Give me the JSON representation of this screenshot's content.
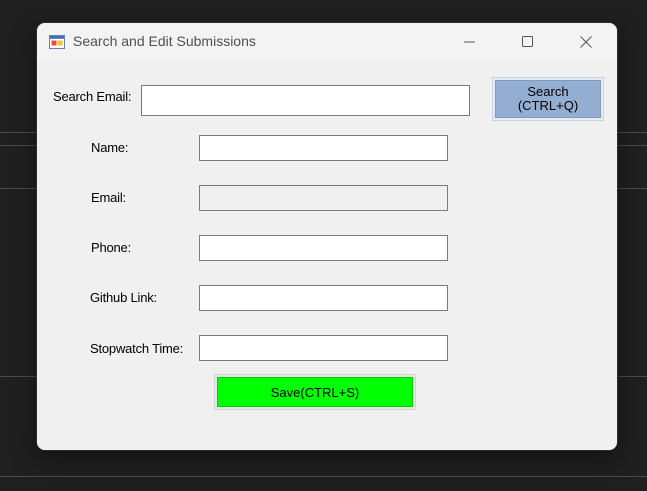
{
  "window": {
    "title": "Search and Edit Submissions",
    "icon": "winforms-app-icon"
  },
  "caption_buttons": {
    "minimize": "minimize-icon",
    "maximize": "maximize-icon",
    "close": "close-icon"
  },
  "search": {
    "label": "Search Email:",
    "value": "",
    "button_label_line1": "Search",
    "button_label_line2": "(CTRL+Q)",
    "button_color": "#94aed2"
  },
  "fields": {
    "name": {
      "label": "Name:",
      "value": ""
    },
    "email": {
      "label": "Email:",
      "value": ""
    },
    "phone": {
      "label": "Phone:",
      "value": ""
    },
    "github": {
      "label": "Github Link:",
      "value": ""
    },
    "stopwatch": {
      "label": "Stopwatch Time:",
      "value": ""
    }
  },
  "save": {
    "label": "Save(CTRL+S)",
    "color": "#00ff00"
  }
}
